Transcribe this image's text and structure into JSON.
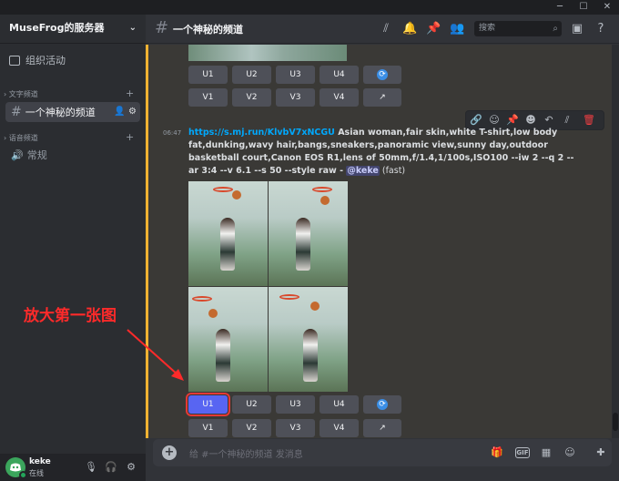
{
  "window": {
    "min": "─",
    "max": "☐",
    "close": "✕"
  },
  "server": {
    "name": "MuseFrog的服务器"
  },
  "sidebar": {
    "events_label": "组织活动",
    "text_category": "文字频道",
    "voice_category": "语音频道",
    "text_channels": [
      {
        "name": "一个神秘的频道"
      }
    ],
    "voice_channels": [
      {
        "name": "常规"
      }
    ]
  },
  "user": {
    "name": "keke",
    "status": "在线"
  },
  "channel": {
    "title": "一个神秘的频道"
  },
  "search": {
    "placeholder": "搜索"
  },
  "message": {
    "time": "06:47",
    "link": "https://s.mj.run/KlvbV7xNCGU",
    "prompt": " Asian woman,fair skin,white T-shirt,low body fat,dunking,wavy hair,bangs,sneakers,panoramic view,sunny day,outdoor basketball court,Canon EOS R1,lens of 50mm,f/1.4,1/100s,ISO100 --iw 2 --q 2 --ar 3:4 --v 6.1 --s 50 --style raw - ",
    "mention": "@keke",
    "mode": " (fast)"
  },
  "buttons": {
    "u": [
      "U1",
      "U2",
      "U3",
      "U4"
    ],
    "v": [
      "V1",
      "V2",
      "V3",
      "V4"
    ],
    "refresh": "⟳",
    "open": "↗"
  },
  "annotation": {
    "text": "放大第一张图",
    "color": "#ff2a2a"
  },
  "composer": {
    "placeholder": "给 #一个神秘的频道 发消息"
  },
  "colors": {
    "accent": "#5865f2",
    "link": "#00a8fc",
    "highlight_bar": "#f0b232"
  }
}
